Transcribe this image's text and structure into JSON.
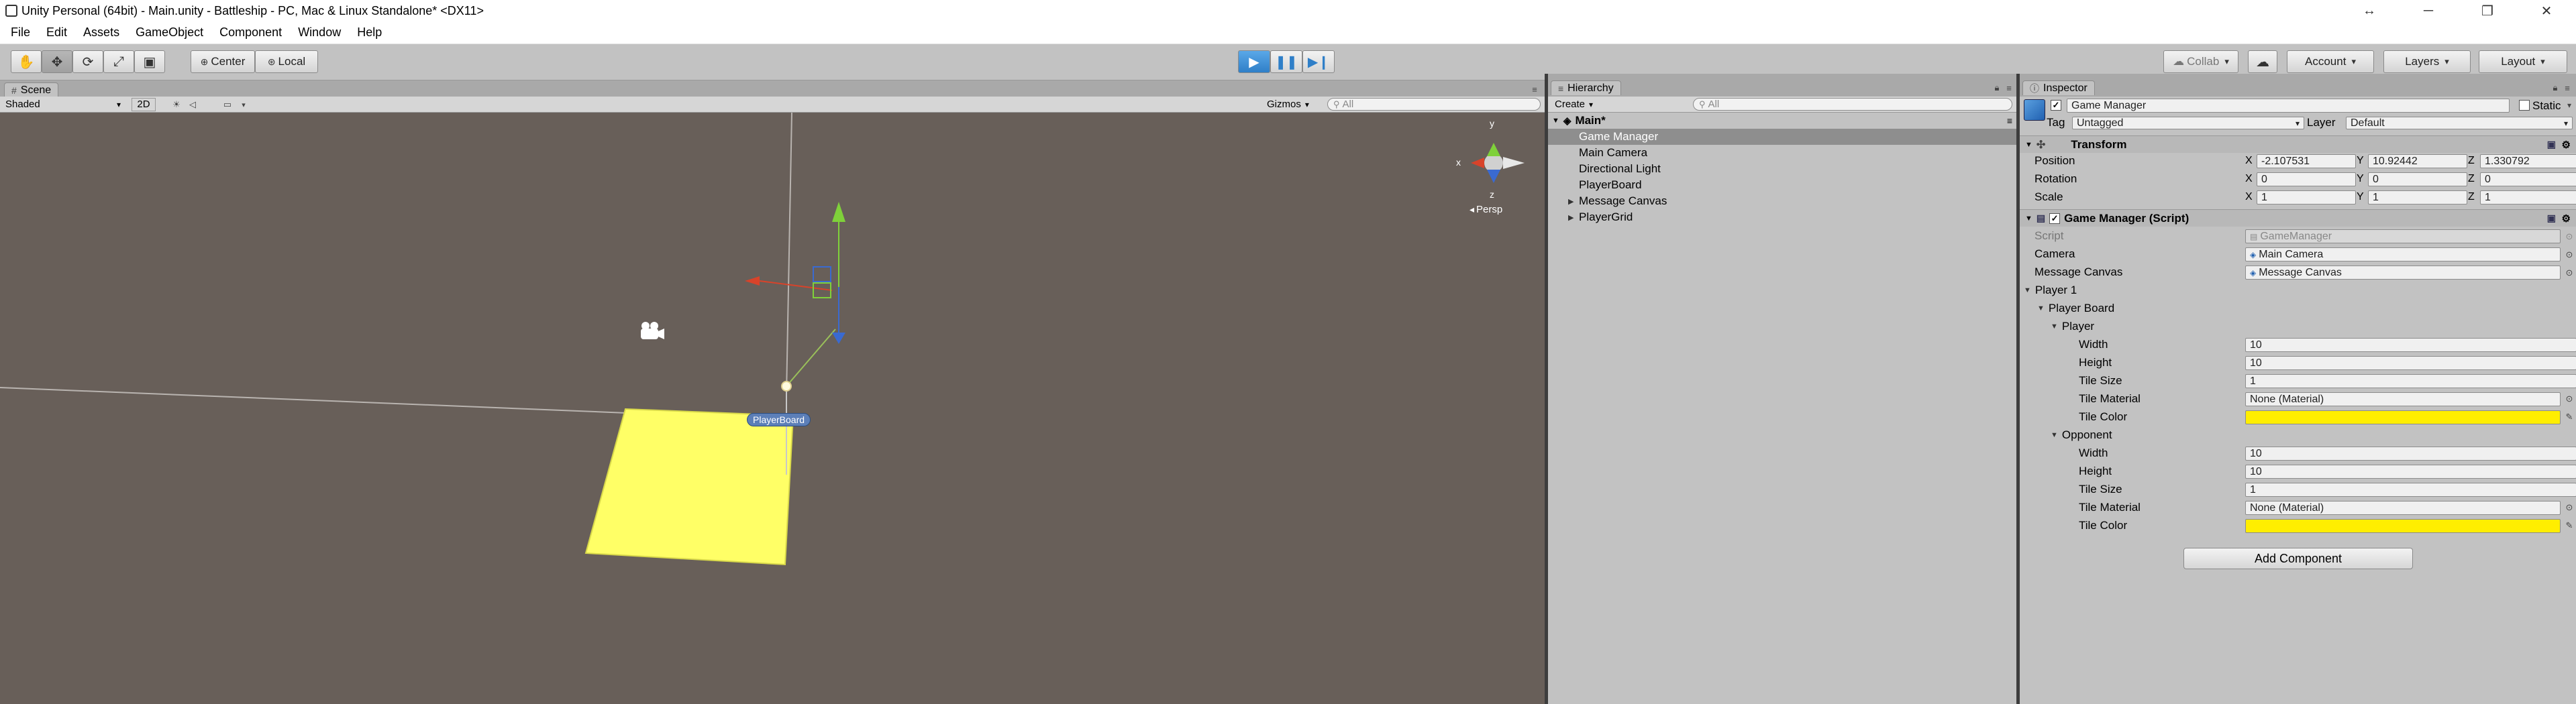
{
  "window": {
    "title": "Unity Personal (64bit) - Main.unity - Battleship - PC, Mac & Linux Standalone* <DX11>",
    "controls": [
      "↔",
      "─",
      "❐",
      "✕"
    ]
  },
  "menu": [
    "File",
    "Edit",
    "Assets",
    "GameObject",
    "Component",
    "Window",
    "Help"
  ],
  "toolbar": {
    "pivot_label": "Center",
    "space_label": "Local",
    "collab_label": "Collab",
    "account_label": "Account",
    "layers_label": "Layers",
    "layout_label": "Layout"
  },
  "scene": {
    "tab_label": "Scene",
    "shading": "Shaded",
    "mode_2d": "2D",
    "gizmos_label": "Gizmos",
    "search_placeholder": "All",
    "persp_label": "Persp",
    "board_label": "PlayerBoard",
    "axis_y": "y",
    "axis_x": "x",
    "axis_z": "z",
    "board_color": "#ffff66"
  },
  "hierarchy": {
    "tab_label": "Hierarchy",
    "create_label": "Create",
    "search_placeholder": "All",
    "scene_name": "Main*",
    "items": [
      {
        "label": "Game Manager",
        "selected": true,
        "expander": false
      },
      {
        "label": "Main Camera",
        "selected": false,
        "expander": false
      },
      {
        "label": "Directional Light",
        "selected": false,
        "expander": false
      },
      {
        "label": "PlayerBoard",
        "selected": false,
        "expander": false
      },
      {
        "label": "Message Canvas",
        "selected": false,
        "expander": true
      },
      {
        "label": "PlayerGrid",
        "selected": false,
        "expander": true
      }
    ]
  },
  "inspector": {
    "tab_label": "Inspector",
    "object_name": "Game Manager",
    "static_label": "Static",
    "tag_label": "Tag",
    "tag_value": "Untagged",
    "layer_label": "Layer",
    "layer_value": "Default",
    "transform": {
      "header": "Transform",
      "position_label": "Position",
      "rotation_label": "Rotation",
      "scale_label": "Scale",
      "axes": [
        "X",
        "Y",
        "Z"
      ],
      "position": [
        "-2.107531",
        "10.92442",
        "1.330792"
      ],
      "rotation": [
        "0",
        "0",
        "0"
      ],
      "scale": [
        "1",
        "1",
        "1"
      ]
    },
    "script_component": {
      "header": "Game Manager (Script)",
      "script_label": "Script",
      "script_value": "GameManager",
      "camera_label": "Camera",
      "camera_value": "Main Camera",
      "canvas_label": "Message Canvas",
      "canvas_value": "Message Canvas",
      "player1_label": "Player 1",
      "board_label": "Player Board",
      "player_label": "Player",
      "opponent_label": "Opponent",
      "width_label": "Width",
      "height_label": "Height",
      "tile_size_label": "Tile Size",
      "tile_material_label": "Tile Material",
      "tile_color_label": "Tile Color",
      "player": {
        "width": "10",
        "height": "10",
        "tile_size": "1",
        "tile_material": "None (Material)",
        "tile_color": "#ffee00"
      },
      "opponent": {
        "width": "10",
        "height": "10",
        "tile_size": "1",
        "tile_material": "None (Material)",
        "tile_color": "#ffee00"
      }
    },
    "add_component_label": "Add Component"
  }
}
